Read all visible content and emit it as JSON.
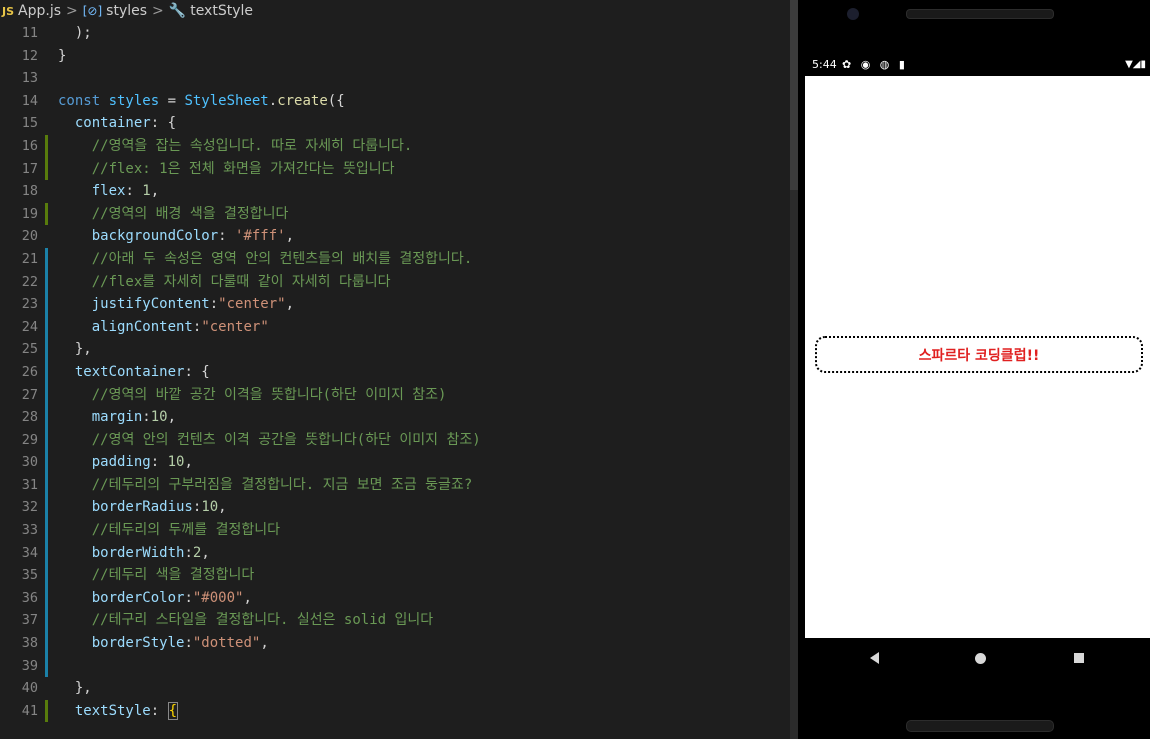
{
  "breadcrumb": {
    "js_badge": "JS",
    "file": "App.js",
    "sep": ">",
    "item2": "styles",
    "item3": "textStyle"
  },
  "code_lines": [
    {
      "n": "11",
      "gutter": "none",
      "indent": 1,
      "tokens": [
        {
          "c": "w",
          "t": ");"
        }
      ]
    },
    {
      "n": "12",
      "gutter": "none",
      "indent": 0,
      "tokens": [
        {
          "c": "w",
          "t": "}"
        }
      ]
    },
    {
      "n": "13",
      "gutter": "none",
      "indent": 0,
      "tokens": []
    },
    {
      "n": "14",
      "gutter": "none",
      "indent": 0,
      "tokens": [
        {
          "c": "k",
          "t": "const "
        },
        {
          "c": "v",
          "t": "styles"
        },
        {
          "c": "w",
          "t": " = "
        },
        {
          "c": "v",
          "t": "StyleSheet"
        },
        {
          "c": "w",
          "t": "."
        },
        {
          "c": "f",
          "t": "create"
        },
        {
          "c": "w",
          "t": "({"
        }
      ]
    },
    {
      "n": "15",
      "gutter": "none",
      "indent": 0,
      "tokens": [
        {
          "c": "p",
          "t": "  container"
        },
        {
          "c": "w",
          "t": ": {"
        }
      ]
    },
    {
      "n": "16",
      "gutter": "green",
      "indent": 1,
      "tokens": [
        {
          "c": "c",
          "t": "  //영역을 잡는 속성입니다. 따로 자세히 다룹니다."
        }
      ]
    },
    {
      "n": "17",
      "gutter": "green",
      "indent": 1,
      "tokens": [
        {
          "c": "c",
          "t": "  //flex: 1은 전체 화면을 가져간다는 뜻입니다"
        }
      ]
    },
    {
      "n": "18",
      "gutter": "none",
      "indent": 1,
      "tokens": [
        {
          "c": "p",
          "t": "  flex"
        },
        {
          "c": "w",
          "t": ": "
        },
        {
          "c": "n",
          "t": "1"
        },
        {
          "c": "w",
          "t": ","
        }
      ]
    },
    {
      "n": "19",
      "gutter": "green",
      "indent": 1,
      "tokens": [
        {
          "c": "c",
          "t": "  //영역의 배경 색을 결정합니다"
        }
      ]
    },
    {
      "n": "20",
      "gutter": "none",
      "indent": 1,
      "tokens": [
        {
          "c": "p",
          "t": "  backgroundColor"
        },
        {
          "c": "w",
          "t": ": "
        },
        {
          "c": "s",
          "t": "'#fff'"
        },
        {
          "c": "w",
          "t": ","
        }
      ]
    },
    {
      "n": "21",
      "gutter": "blue",
      "indent": 1,
      "tokens": [
        {
          "c": "c",
          "t": "  //아래 두 속성은 영역 안의 컨텐츠들의 배치를 결정합니다."
        }
      ]
    },
    {
      "n": "22",
      "gutter": "blue",
      "indent": 1,
      "tokens": [
        {
          "c": "c",
          "t": "  //flex를 자세히 다룰때 같이 자세히 다룹니다"
        }
      ]
    },
    {
      "n": "23",
      "gutter": "blue",
      "indent": 1,
      "tokens": [
        {
          "c": "p",
          "t": "  justifyContent"
        },
        {
          "c": "w",
          "t": ":"
        },
        {
          "c": "s",
          "t": "\"center\""
        },
        {
          "c": "w",
          "t": ","
        }
      ]
    },
    {
      "n": "24",
      "gutter": "blue",
      "indent": 1,
      "tokens": [
        {
          "c": "p",
          "t": "  alignContent"
        },
        {
          "c": "w",
          "t": ":"
        },
        {
          "c": "s",
          "t": "\"center\""
        }
      ]
    },
    {
      "n": "25",
      "gutter": "blue",
      "indent": 0,
      "tokens": [
        {
          "c": "w",
          "t": "  },"
        }
      ]
    },
    {
      "n": "26",
      "gutter": "blue",
      "indent": 0,
      "tokens": [
        {
          "c": "p",
          "t": "  textContainer"
        },
        {
          "c": "w",
          "t": ": {"
        }
      ]
    },
    {
      "n": "27",
      "gutter": "blue",
      "indent": 1,
      "tokens": [
        {
          "c": "c",
          "t": "  //영역의 바깥 공간 이격을 뜻합니다(하단 이미지 참조)"
        }
      ]
    },
    {
      "n": "28",
      "gutter": "blue",
      "indent": 1,
      "tokens": [
        {
          "c": "p",
          "t": "  margin"
        },
        {
          "c": "w",
          "t": ":"
        },
        {
          "c": "n",
          "t": "10"
        },
        {
          "c": "w",
          "t": ","
        }
      ]
    },
    {
      "n": "29",
      "gutter": "blue",
      "indent": 1,
      "tokens": [
        {
          "c": "c",
          "t": "  //영역 안의 컨텐츠 이격 공간을 뜻합니다(하단 이미지 참조)"
        }
      ]
    },
    {
      "n": "30",
      "gutter": "blue",
      "indent": 1,
      "tokens": [
        {
          "c": "p",
          "t": "  padding"
        },
        {
          "c": "w",
          "t": ": "
        },
        {
          "c": "n",
          "t": "10"
        },
        {
          "c": "w",
          "t": ","
        }
      ]
    },
    {
      "n": "31",
      "gutter": "blue",
      "indent": 1,
      "tokens": [
        {
          "c": "c",
          "t": "  //테두리의 구부러짐을 결정합니다. 지금 보면 조금 둥글죠?"
        }
      ]
    },
    {
      "n": "32",
      "gutter": "blue",
      "indent": 1,
      "tokens": [
        {
          "c": "p",
          "t": "  borderRadius"
        },
        {
          "c": "w",
          "t": ":"
        },
        {
          "c": "n",
          "t": "10"
        },
        {
          "c": "w",
          "t": ","
        }
      ]
    },
    {
      "n": "33",
      "gutter": "blue",
      "indent": 1,
      "tokens": [
        {
          "c": "c",
          "t": "  //테두리의 두께를 결정합니다"
        }
      ]
    },
    {
      "n": "34",
      "gutter": "blue",
      "indent": 1,
      "tokens": [
        {
          "c": "p",
          "t": "  borderWidth"
        },
        {
          "c": "w",
          "t": ":"
        },
        {
          "c": "n",
          "t": "2"
        },
        {
          "c": "w",
          "t": ","
        }
      ]
    },
    {
      "n": "35",
      "gutter": "blue",
      "indent": 1,
      "tokens": [
        {
          "c": "c",
          "t": "  //테두리 색을 결정합니다"
        }
      ]
    },
    {
      "n": "36",
      "gutter": "blue",
      "indent": 1,
      "tokens": [
        {
          "c": "p",
          "t": "  borderColor"
        },
        {
          "c": "w",
          "t": ":"
        },
        {
          "c": "s",
          "t": "\"#000\""
        },
        {
          "c": "w",
          "t": ","
        }
      ]
    },
    {
      "n": "37",
      "gutter": "blue",
      "indent": 1,
      "tokens": [
        {
          "c": "c",
          "t": "  //테구리 스타일을 결정합니다. 실선은 solid 입니다"
        }
      ]
    },
    {
      "n": "38",
      "gutter": "blue",
      "indent": 1,
      "tokens": [
        {
          "c": "p",
          "t": "  borderStyle"
        },
        {
          "c": "w",
          "t": ":"
        },
        {
          "c": "s",
          "t": "\"dotted\""
        },
        {
          "c": "w",
          "t": ","
        }
      ]
    },
    {
      "n": "39",
      "gutter": "blue",
      "indent": 1,
      "tokens": []
    },
    {
      "n": "40",
      "gutter": "none",
      "indent": 0,
      "tokens": [
        {
          "c": "w",
          "t": "  },"
        }
      ]
    },
    {
      "n": "41",
      "gutter": "green",
      "indent": 0,
      "tokens": [
        {
          "c": "p",
          "t": "  textStyle"
        },
        {
          "c": "w",
          "t": ": "
        },
        {
          "c": "y",
          "t": "{"
        }
      ]
    }
  ],
  "phone": {
    "time": "5:44",
    "status_icons": "✿ ◉ ◍ ▮",
    "right_icons": "▼◢▮",
    "text_box_label": "스파르타 코딩클럽!!"
  },
  "colors": {
    "editor_bg": "#1e1e1e",
    "comment": "#6a9955",
    "string": "#ce9178",
    "property": "#9cdcfe",
    "keyword": "#569cd6",
    "accent_red": "#e02020"
  }
}
